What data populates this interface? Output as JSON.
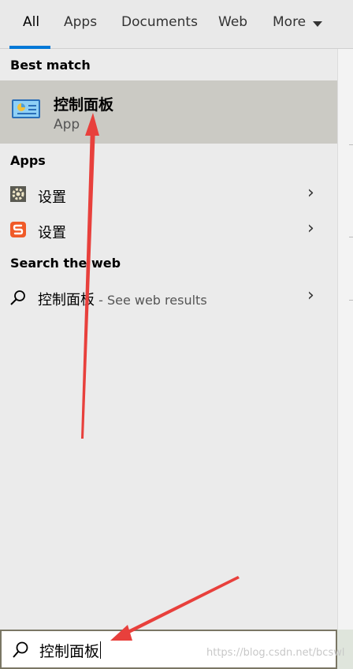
{
  "tabs": [
    {
      "label": "All",
      "active": true
    },
    {
      "label": "Apps",
      "active": false
    },
    {
      "label": "Documents",
      "active": false
    },
    {
      "label": "Web",
      "active": false
    },
    {
      "label": "More",
      "active": false
    }
  ],
  "sections": {
    "best_match": "Best match",
    "apps": "Apps",
    "search_web": "Search the web"
  },
  "best_match": {
    "title": "控制面板",
    "subtitle": "App",
    "icon": "control-panel-icon"
  },
  "apps": [
    {
      "label": "设置",
      "icon": "gear-icon"
    },
    {
      "label": "设置",
      "icon": "sogou-s-icon"
    }
  ],
  "web_result": {
    "query": "控制面板",
    "suffix": " - See web results",
    "icon": "search-icon"
  },
  "search": {
    "value": "控制面板"
  },
  "watermark": "https://blog.csdn.net/bcswl",
  "colors": {
    "accent": "#0078d7",
    "highlight": "#cbcac4",
    "arrow": "#e8403c"
  }
}
